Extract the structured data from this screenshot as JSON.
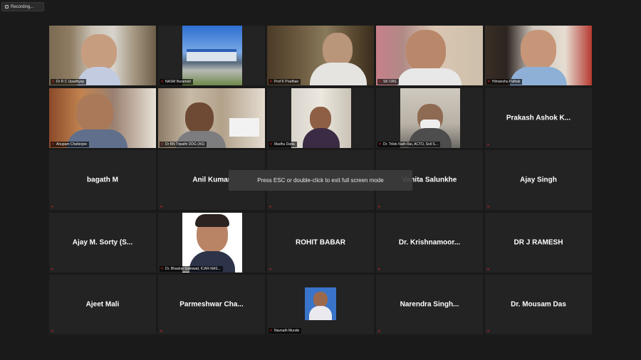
{
  "recording": {
    "label": "Recording..."
  },
  "toast": {
    "text": "Press ESC or double-click to exit full screen mode"
  },
  "tiles": [
    {
      "name": "Dr R C Upadhyay"
    },
    {
      "name": "NASM Baramati"
    },
    {
      "name": "Prof K Pradhan"
    },
    {
      "name": "SK OAS"
    },
    {
      "name": "Himanshu Pathak"
    },
    {
      "name": "Anupam Chatterjee"
    },
    {
      "name": "Dr BN Tripathi DDG (AS)"
    },
    {
      "name": "Madhu Datta"
    },
    {
      "name": "Dr. Trilok Nath Rai, ACTO, Soil S..."
    },
    {
      "name": "Prakash Ashok K..."
    },
    {
      "name": "bagath M"
    },
    {
      "name": "Anil Kumar"
    },
    {
      "name": ""
    },
    {
      "name": "Vanita Salunkhe"
    },
    {
      "name": "Ajay Singh"
    },
    {
      "name": "Ajay M. Sorty (S..."
    },
    {
      "name": "Dr. Bhaskar Gaikwad, ICAR-NAS..."
    },
    {
      "name": "ROHIT BABAR"
    },
    {
      "name": "Dr. Krishnamoor..."
    },
    {
      "name": "DR J RAMESH"
    },
    {
      "name": "Ajeet Mali"
    },
    {
      "name": "Parmeshwar Cha..."
    },
    {
      "name": "Navnath Munde"
    },
    {
      "name": "Narendra Singh..."
    },
    {
      "name": "Dr. Mousam Das"
    }
  ],
  "icons": {
    "muted_mic": "mic-muted-icon",
    "recording": "recording-icon"
  },
  "colors": {
    "active_speaker": "#9bd03a",
    "muted": "#e0262b"
  }
}
